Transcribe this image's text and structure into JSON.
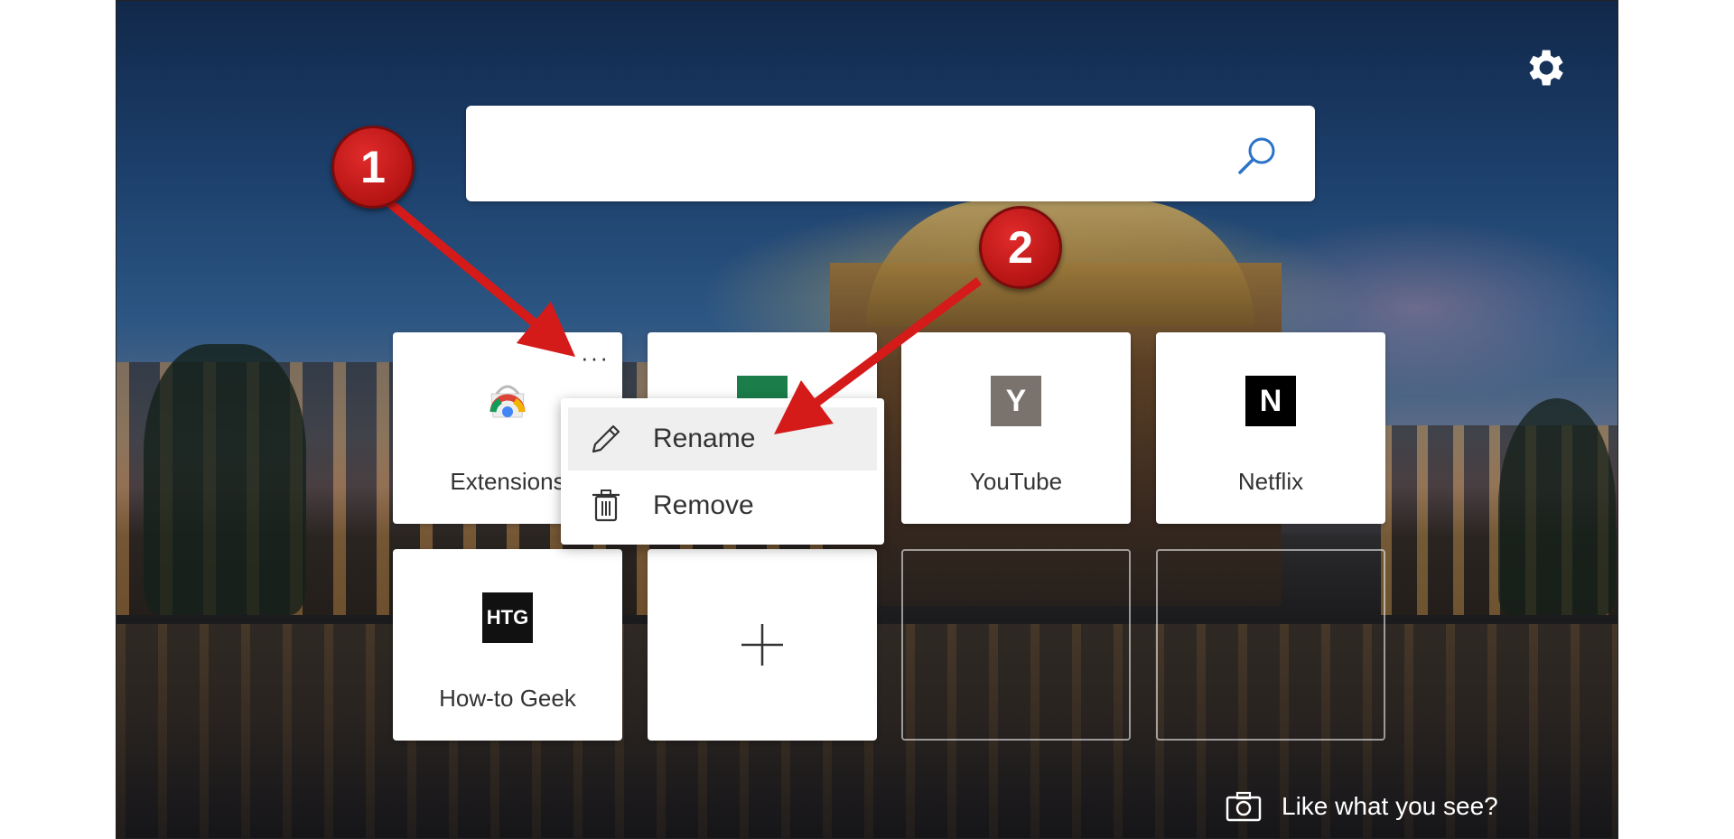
{
  "search": {
    "value": "",
    "placeholder": ""
  },
  "tiles": [
    {
      "label": "Extensions",
      "icon": "chrome-web-store-icon",
      "more": "···"
    },
    {
      "label": "",
      "icon": "green-app-icon"
    },
    {
      "label": "YouTube",
      "logo": "Y",
      "icon": "youtube-logo-icon",
      "logo_color": "#7a726c"
    },
    {
      "label": "Netflix",
      "logo": "N",
      "icon": "netflix-logo-icon",
      "logo_color": "#000000"
    },
    {
      "label": "How-to Geek",
      "logo": "HTG",
      "icon": "htg-logo-icon",
      "logo_color": "#111111"
    },
    {
      "label": "",
      "icon": "add-icon"
    }
  ],
  "context_menu": {
    "items": [
      {
        "label": "Rename",
        "icon": "pencil-icon"
      },
      {
        "label": "Remove",
        "icon": "trash-icon"
      }
    ]
  },
  "annotations": {
    "badge_1": "1",
    "badge_2": "2",
    "badge_color": "#c81818"
  },
  "footer": {
    "label": "Like what you see?",
    "icon": "camera-icon"
  }
}
